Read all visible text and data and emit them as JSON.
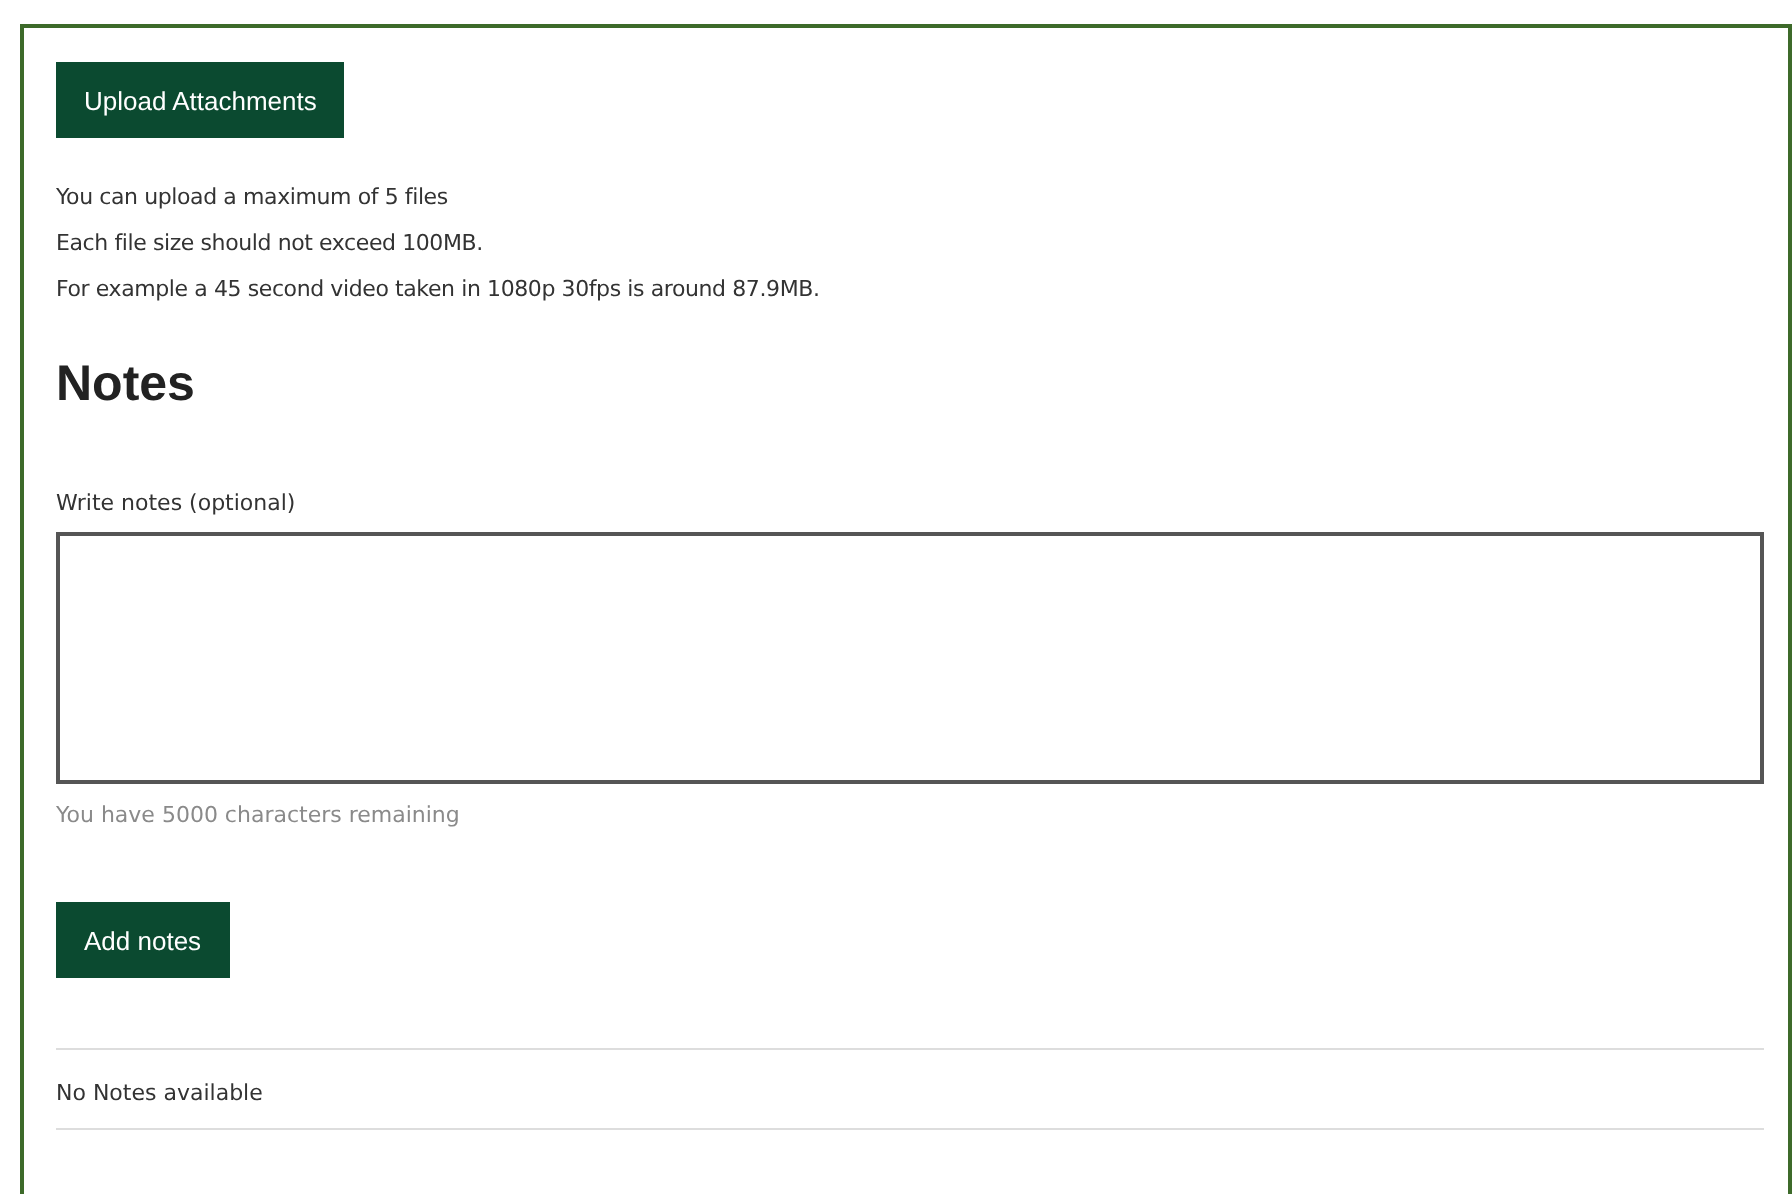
{
  "upload_button": "Upload Attachments",
  "info_lines": [
    "You can upload a maximum of 5 files",
    "Each file size should not exceed 100MB.",
    "For example a 45 second video taken in 1080p 30fps is around 87.9MB."
  ],
  "notes": {
    "heading": "Notes",
    "label": "Write notes (optional)",
    "remaining": "You have 5000 characters remaining",
    "add_button": "Add notes",
    "empty_message": "No Notes available"
  }
}
